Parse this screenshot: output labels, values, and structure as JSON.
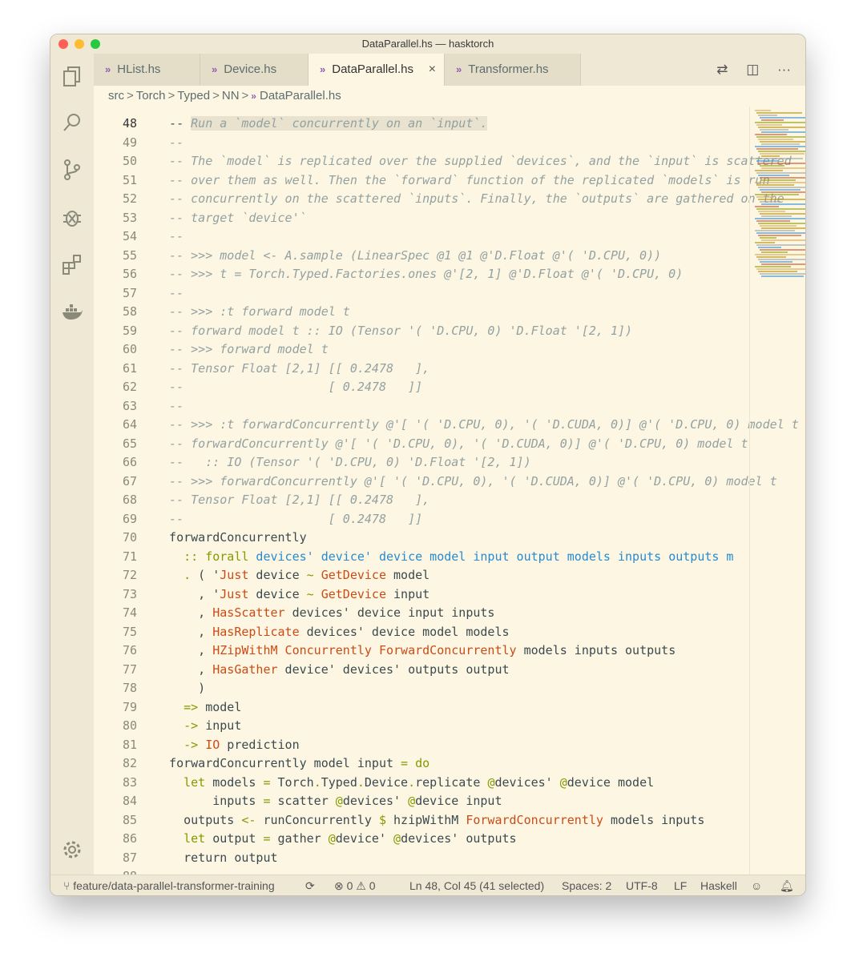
{
  "window": {
    "title": "DataParallel.hs — hasktorch"
  },
  "activity_bar": {
    "icons": [
      "files-icon",
      "search-icon",
      "source-control-icon",
      "debug-icon",
      "extensions-icon",
      "docker-icon",
      "settings-gear-icon"
    ]
  },
  "tabs": [
    {
      "label": "HList.hs",
      "active": false
    },
    {
      "label": "Device.hs",
      "active": false
    },
    {
      "label": "DataParallel.hs",
      "active": true,
      "close": "×"
    },
    {
      "label": "Transformer.hs",
      "active": false
    }
  ],
  "tab_actions": {
    "compare": "⇄",
    "split": "◫",
    "more": "···"
  },
  "breadcrumb": {
    "items": [
      "src",
      "Torch",
      "Typed",
      "NN",
      "DataParallel.hs"
    ],
    "separator": ">"
  },
  "editor": {
    "lines": [
      {
        "n": "48",
        "segs": [
          {
            "t": "  -- "
          },
          {
            "t": "Run a `model` concurrently on an `input`.",
            "c": "c sel"
          }
        ]
      },
      {
        "n": "49",
        "segs": [
          {
            "t": "  --",
            "c": "c"
          }
        ]
      },
      {
        "n": "50",
        "segs": [
          {
            "t": "  -- The `model` is replicated over the supplied `devices`, and the `input` is scattered",
            "c": "c"
          }
        ]
      },
      {
        "n": "51",
        "segs": [
          {
            "t": "  -- over them as well. Then the `forward` function of the replicated `models` is run",
            "c": "c"
          }
        ]
      },
      {
        "n": "52",
        "segs": [
          {
            "t": "  -- concurrently on the scattered `inputs`. Finally, the `outputs` are gathered on the",
            "c": "c"
          }
        ]
      },
      {
        "n": "53",
        "segs": [
          {
            "t": "  -- target `device'`",
            "c": "c"
          }
        ]
      },
      {
        "n": "54",
        "segs": [
          {
            "t": "  --",
            "c": "c"
          }
        ]
      },
      {
        "n": "55",
        "segs": [
          {
            "t": "  -- >>> model <- A.sample (LinearSpec @1 @1 @'D.Float @'( 'D.CPU, 0))",
            "c": "c"
          }
        ]
      },
      {
        "n": "56",
        "segs": [
          {
            "t": "  -- >>> t = Torch.Typed.Factories.ones @'[2, 1] @'D.Float @'( 'D.CPU, 0)",
            "c": "c"
          }
        ]
      },
      {
        "n": "57",
        "segs": [
          {
            "t": "  --",
            "c": "c"
          }
        ]
      },
      {
        "n": "58",
        "segs": [
          {
            "t": "  -- >>> :t forward model t",
            "c": "c"
          }
        ]
      },
      {
        "n": "59",
        "segs": [
          {
            "t": "  -- forward model t :: IO (Tensor '( 'D.CPU, 0) 'D.Float '[2, 1])",
            "c": "c"
          }
        ]
      },
      {
        "n": "60",
        "segs": [
          {
            "t": "  -- >>> forward model t",
            "c": "c"
          }
        ]
      },
      {
        "n": "61",
        "segs": [
          {
            "t": "  -- Tensor Float [2,1] [[ 0.2478   ],",
            "c": "c"
          }
        ]
      },
      {
        "n": "62",
        "segs": [
          {
            "t": "  --                    [ 0.2478   ]]",
            "c": "c"
          }
        ]
      },
      {
        "n": "63",
        "segs": [
          {
            "t": "  --",
            "c": "c"
          }
        ]
      },
      {
        "n": "64",
        "segs": [
          {
            "t": "  -- >>> :t forwardConcurrently @'[ '( 'D.CPU, 0), '( 'D.CUDA, 0)] @'( 'D.CPU, 0) model t",
            "c": "c"
          }
        ]
      },
      {
        "n": "65",
        "segs": [
          {
            "t": "  -- forwardConcurrently @'[ '( 'D.CPU, 0), '( 'D.CUDA, 0)] @'( 'D.CPU, 0) model t",
            "c": "c"
          }
        ]
      },
      {
        "n": "66",
        "segs": [
          {
            "t": "  --   :: IO (Tensor '( 'D.CPU, 0) 'D.Float '[2, 1])",
            "c": "c"
          }
        ]
      },
      {
        "n": "67",
        "segs": [
          {
            "t": "  -- >>> forwardConcurrently @'[ '( 'D.CPU, 0), '( 'D.CUDA, 0)] @'( 'D.CPU, 0) model t",
            "c": "c"
          }
        ]
      },
      {
        "n": "68",
        "segs": [
          {
            "t": "  -- Tensor Float [2,1] [[ 0.2478   ],",
            "c": "c"
          }
        ]
      },
      {
        "n": "69",
        "segs": [
          {
            "t": "  --                    [ 0.2478   ]]",
            "c": "c"
          }
        ]
      },
      {
        "n": "70",
        "segs": [
          {
            "t": "  forwardConcurrently"
          }
        ]
      },
      {
        "n": "71",
        "segs": [
          {
            "t": "    "
          },
          {
            "t": ":: forall",
            "c": "k"
          },
          {
            "t": " devices' device' device model input output models inputs outputs m",
            "c": "b"
          }
        ]
      },
      {
        "n": "72",
        "segs": [
          {
            "t": "    "
          },
          {
            "t": ".",
            "c": "k"
          },
          {
            "t": " ( '"
          },
          {
            "t": "Just",
            "c": "o"
          },
          {
            "t": " device "
          },
          {
            "t": "~",
            "c": "k"
          },
          {
            "t": " "
          },
          {
            "t": "GetDevice",
            "c": "o"
          },
          {
            "t": " model"
          }
        ]
      },
      {
        "n": "73",
        "segs": [
          {
            "t": "      , '"
          },
          {
            "t": "Just",
            "c": "o"
          },
          {
            "t": " device "
          },
          {
            "t": "~",
            "c": "k"
          },
          {
            "t": " "
          },
          {
            "t": "GetDevice",
            "c": "o"
          },
          {
            "t": " input"
          }
        ]
      },
      {
        "n": "74",
        "segs": [
          {
            "t": "      , "
          },
          {
            "t": "HasScatter",
            "c": "o"
          },
          {
            "t": " devices' device input inputs"
          }
        ]
      },
      {
        "n": "75",
        "segs": [
          {
            "t": "      , "
          },
          {
            "t": "HasReplicate",
            "c": "o"
          },
          {
            "t": " devices' device model models"
          }
        ]
      },
      {
        "n": "76",
        "segs": [
          {
            "t": "      , "
          },
          {
            "t": "HZipWithM Concurrently ForwardConcurrently",
            "c": "o"
          },
          {
            "t": " models inputs outputs"
          }
        ]
      },
      {
        "n": "77",
        "segs": [
          {
            "t": "      , "
          },
          {
            "t": "HasGather",
            "c": "o"
          },
          {
            "t": " device' devices' outputs output"
          }
        ]
      },
      {
        "n": "78",
        "segs": [
          {
            "t": "      )"
          }
        ]
      },
      {
        "n": "79",
        "segs": [
          {
            "t": "    "
          },
          {
            "t": "=>",
            "c": "k"
          },
          {
            "t": " model"
          }
        ]
      },
      {
        "n": "80",
        "segs": [
          {
            "t": "    "
          },
          {
            "t": "->",
            "c": "k"
          },
          {
            "t": " input"
          }
        ]
      },
      {
        "n": "81",
        "segs": [
          {
            "t": "    "
          },
          {
            "t": "->",
            "c": "k"
          },
          {
            "t": " "
          },
          {
            "t": "IO",
            "c": "o"
          },
          {
            "t": " prediction"
          }
        ]
      },
      {
        "n": "82",
        "segs": [
          {
            "t": "  forwardConcurrently model input "
          },
          {
            "t": "= do",
            "c": "k"
          }
        ]
      },
      {
        "n": "83",
        "segs": [
          {
            "t": "    "
          },
          {
            "t": "let",
            "c": "k"
          },
          {
            "t": " models "
          },
          {
            "t": "=",
            "c": "k"
          },
          {
            "t": " Torch"
          },
          {
            "t": ".",
            "c": "k"
          },
          {
            "t": "Typed"
          },
          {
            "t": ".",
            "c": "k"
          },
          {
            "t": "Device"
          },
          {
            "t": ".",
            "c": "k"
          },
          {
            "t": "replicate "
          },
          {
            "t": "@",
            "c": "k"
          },
          {
            "t": "devices' "
          },
          {
            "t": "@",
            "c": "k"
          },
          {
            "t": "device model"
          }
        ]
      },
      {
        "n": "84",
        "segs": [
          {
            "t": "        inputs "
          },
          {
            "t": "=",
            "c": "k"
          },
          {
            "t": " scatter "
          },
          {
            "t": "@",
            "c": "k"
          },
          {
            "t": "devices' "
          },
          {
            "t": "@",
            "c": "k"
          },
          {
            "t": "device input"
          }
        ]
      },
      {
        "n": "85",
        "segs": [
          {
            "t": "    outputs "
          },
          {
            "t": "<-",
            "c": "k"
          },
          {
            "t": " runConcurrently "
          },
          {
            "t": "$",
            "c": "k"
          },
          {
            "t": " hzipWithM "
          },
          {
            "t": "ForwardConcurrently",
            "c": "o"
          },
          {
            "t": " models inputs"
          }
        ]
      },
      {
        "n": "86",
        "segs": [
          {
            "t": "    "
          },
          {
            "t": "let",
            "c": "k"
          },
          {
            "t": " output "
          },
          {
            "t": "=",
            "c": "k"
          },
          {
            "t": " gather "
          },
          {
            "t": "@",
            "c": "k"
          },
          {
            "t": "device' "
          },
          {
            "t": "@",
            "c": "k"
          },
          {
            "t": "devices' outputs"
          }
        ]
      },
      {
        "n": "87",
        "segs": [
          {
            "t": "    return output"
          }
        ]
      },
      {
        "n": "88",
        "segs": [
          {
            "t": ""
          }
        ]
      }
    ]
  },
  "status_bar": {
    "branch": "feature/data-parallel-transformer-training",
    "sync_icon": "⟳",
    "errors": "0",
    "warnings": "0",
    "cursor": "Ln 48, Col 45 (41 selected)",
    "spaces": "Spaces: 2",
    "encoding": "UTF-8",
    "eol": "LF",
    "language": "Haskell",
    "feedback_icon": "☺",
    "bell_icon": "🔔︎"
  },
  "colors": {
    "background": "#fdf6e3",
    "chrome": "#eee8d5",
    "comment": "#93a1a1",
    "keyword": "#859900",
    "type": "#cb4b16",
    "var": "#268bd2"
  }
}
